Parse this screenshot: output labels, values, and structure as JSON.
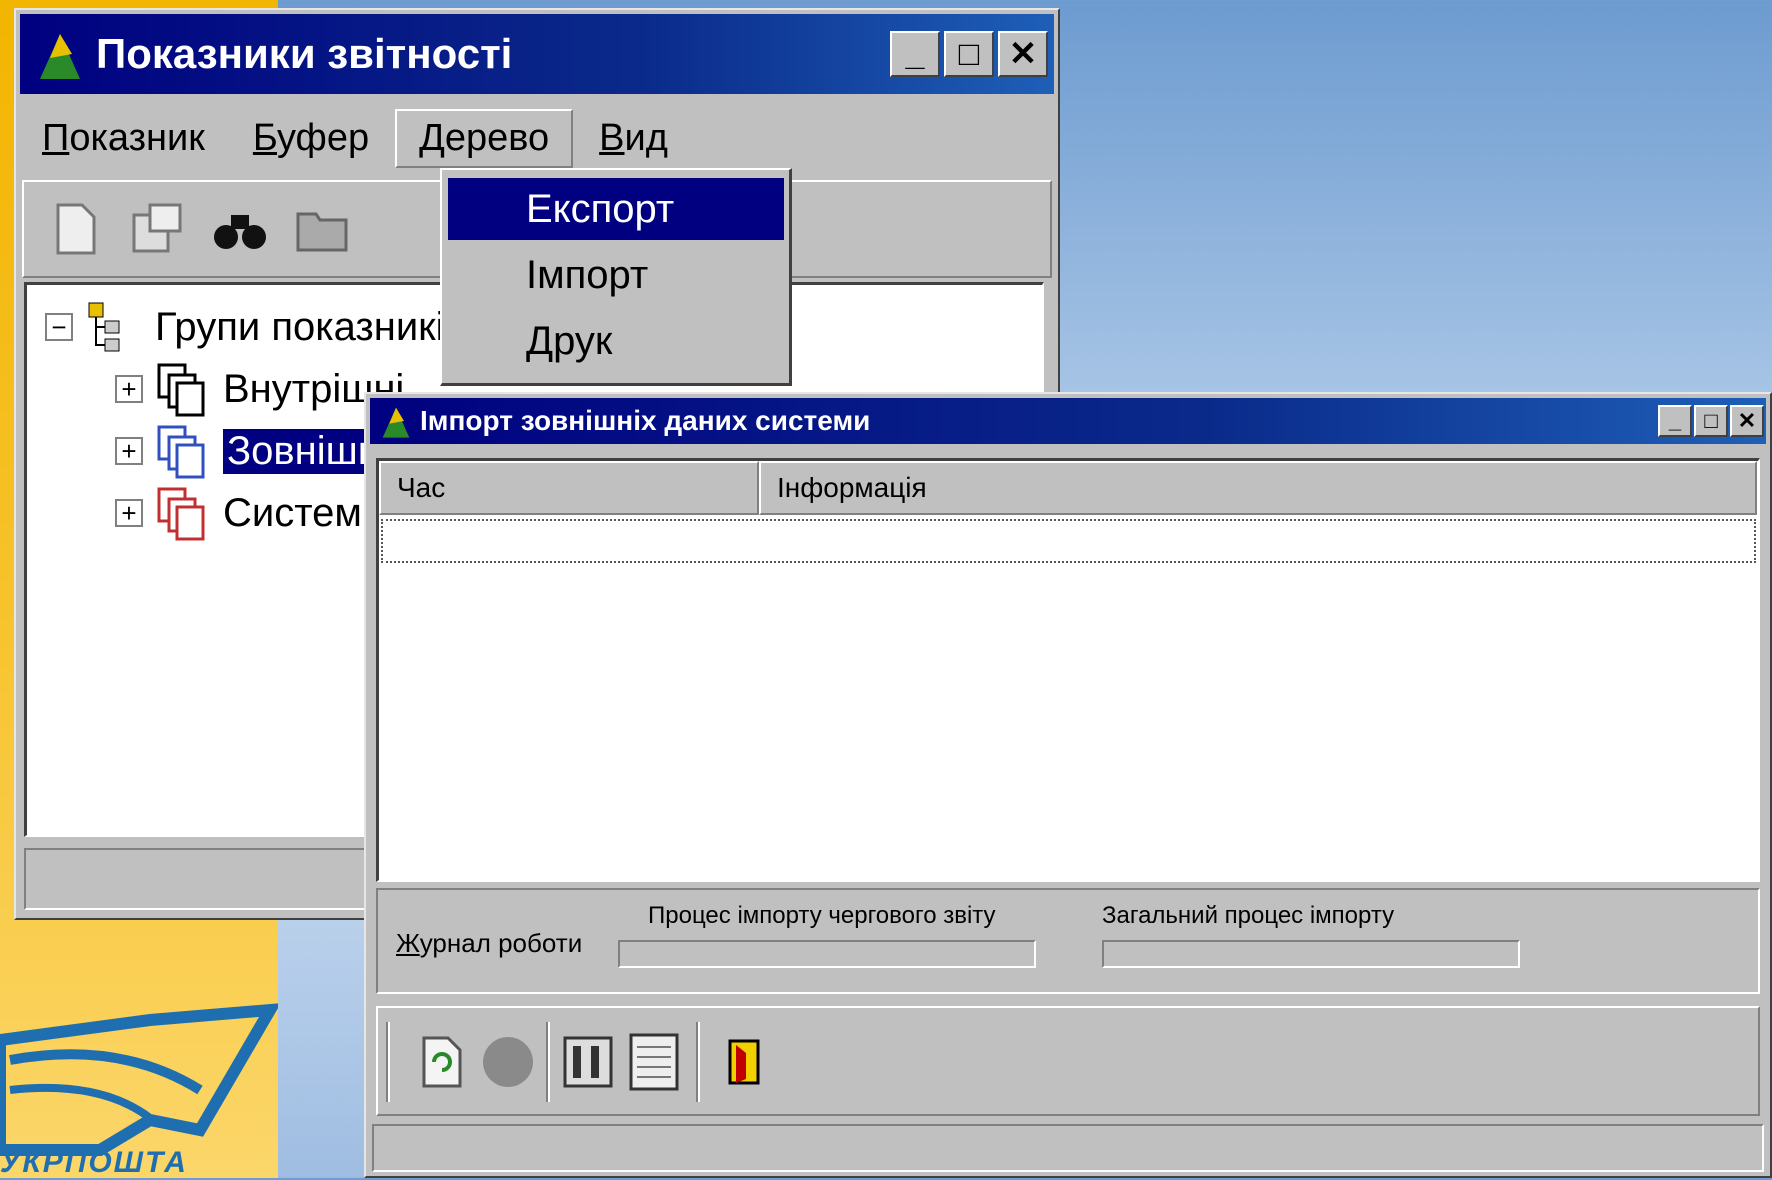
{
  "main_window": {
    "title": "Показники звітності",
    "menu": [
      {
        "key": "П",
        "rest": "оказник"
      },
      {
        "key": "Б",
        "rest": "уфер"
      },
      {
        "key": "Д",
        "rest": "ерево"
      },
      {
        "key": "В",
        "rest": "ид"
      }
    ],
    "toolbar_icons": [
      "new-document-icon",
      "properties-icon",
      "binoculars-icon",
      "folder-icon"
    ],
    "tree": {
      "root": "Групи показників",
      "children": [
        "Внутрішні",
        "Зовнішні",
        "Системні"
      ],
      "selected_index": 1
    }
  },
  "tree_menu": {
    "items": [
      "Експорт",
      "Імпорт",
      "Друк"
    ],
    "highlighted": "Експорт"
  },
  "import_window": {
    "title": "Імпорт зовнішніх даних системи",
    "columns": [
      "Час",
      "Інформація"
    ],
    "log_label": {
      "key": "Ж",
      "rest": "урнал роботи"
    },
    "progress_current_label": "Процес імпорту чергового звіту",
    "progress_total_label": "Загальний процес імпорту",
    "progress_current": 0,
    "progress_total": 0,
    "toolbar_icons": [
      "refresh-icon",
      "stop-icon",
      "settings-icon",
      "log-icon",
      "exit-icon"
    ]
  },
  "logo_text": "УКРПОШТА",
  "colors": {
    "title_bar": "#000080",
    "selection": "#000080",
    "window_face": "#c0c0c0",
    "desktop_accent": "#f2b500"
  }
}
